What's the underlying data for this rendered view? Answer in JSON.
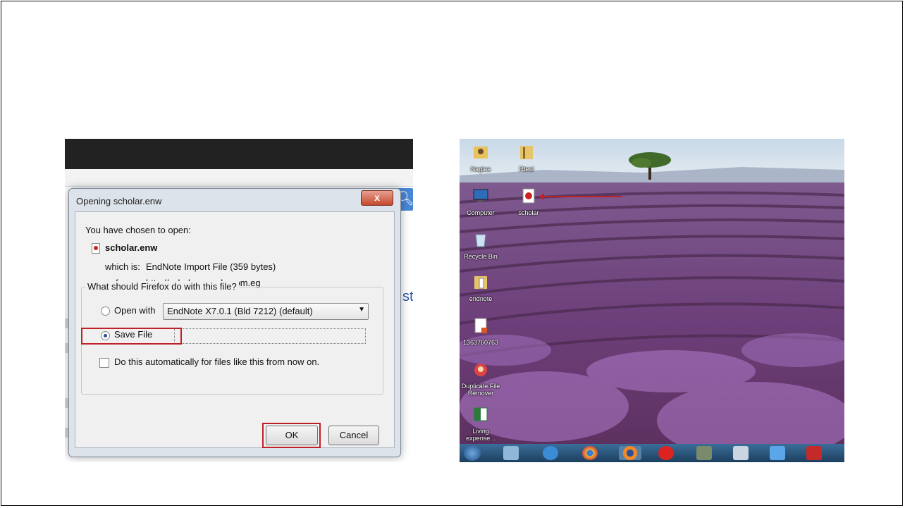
{
  "dialog": {
    "title": "Opening scholar.enw",
    "close_label": "x",
    "intro": "You have chosen to open:",
    "filename": "scholar.enw",
    "which_is_label": "which is:",
    "which_is_value": "EndNote Import File (359 bytes)",
    "from_label": "from:",
    "from_value": "http://scholar.google.com.eg",
    "question": "What should Firefox do with this file?",
    "open_with_label": "Open with",
    "open_with_option": "EndNote X7.0.1 (Bld 7212) (default)",
    "save_file_label": "Save File",
    "auto_checkbox_label": "Do this automatically for files like this from now on.",
    "ok_label": "OK",
    "cancel_label": "Cancel",
    "selected_action": "save-file"
  },
  "browser": {
    "search_icon": "search-icon",
    "background_fragment": "sta"
  },
  "desktop": {
    "icons": [
      {
        "label": "Naglaa",
        "icon": "folder-user-icon"
      },
      {
        "label": "Rtest",
        "icon": "folder-icon"
      },
      {
        "label": "Computer",
        "icon": "computer-icon"
      },
      {
        "label": "scholar",
        "icon": "enw-file-icon"
      },
      {
        "label": "Recycle Bin",
        "icon": "recycle-bin-icon"
      },
      {
        "label": "endnote",
        "icon": "folder-icon"
      },
      {
        "label": "1363760763",
        "icon": "document-icon"
      },
      {
        "label": "Duplicate File Remover",
        "icon": "app-icon"
      },
      {
        "label": "Living expense...",
        "icon": "excel-icon"
      }
    ],
    "taskbar_items": [
      "start-icon",
      "explorer-icon",
      "ie-icon",
      "chrome-icon",
      "firefox-icon",
      "opera-icon",
      "app-icon",
      "calculator-icon",
      "dropbox-icon",
      "endnote-icon"
    ],
    "colors": {
      "highlight": "#c0202a",
      "taskbar": "#2a5478",
      "lavender": "#8a5a9e",
      "sky": "#dbe8f2"
    }
  }
}
